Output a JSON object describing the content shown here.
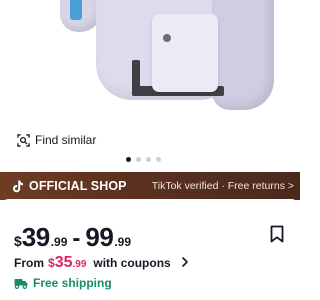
{
  "product": {
    "image_alt": "Handheld console grip with battery pack",
    "carousel": {
      "count": 4,
      "active_index": 0
    }
  },
  "find_similar": {
    "label": "Find similar",
    "icon": "image-search-icon"
  },
  "shop_banner": {
    "logo": "tiktok-logo",
    "label": "OFFICIAL SHOP",
    "right_text": "TikTok verified · Free returns >"
  },
  "price": {
    "low": {
      "currency": "$",
      "whole": "39",
      "cents": ".99"
    },
    "separator": "-",
    "high": {
      "whole": "99",
      "cents": ".99"
    }
  },
  "coupon": {
    "prefix": "From",
    "currency": "$",
    "whole": "35",
    "cents": ".99",
    "suffix": "with coupons"
  },
  "shipping": {
    "label": "Free shipping",
    "icon": "truck-icon"
  },
  "colors": {
    "banner_start": "#6e3c23",
    "banner_end": "#4a2a1d",
    "coupon_price": "#e0245e",
    "shipping_text": "#1b8a6b"
  }
}
